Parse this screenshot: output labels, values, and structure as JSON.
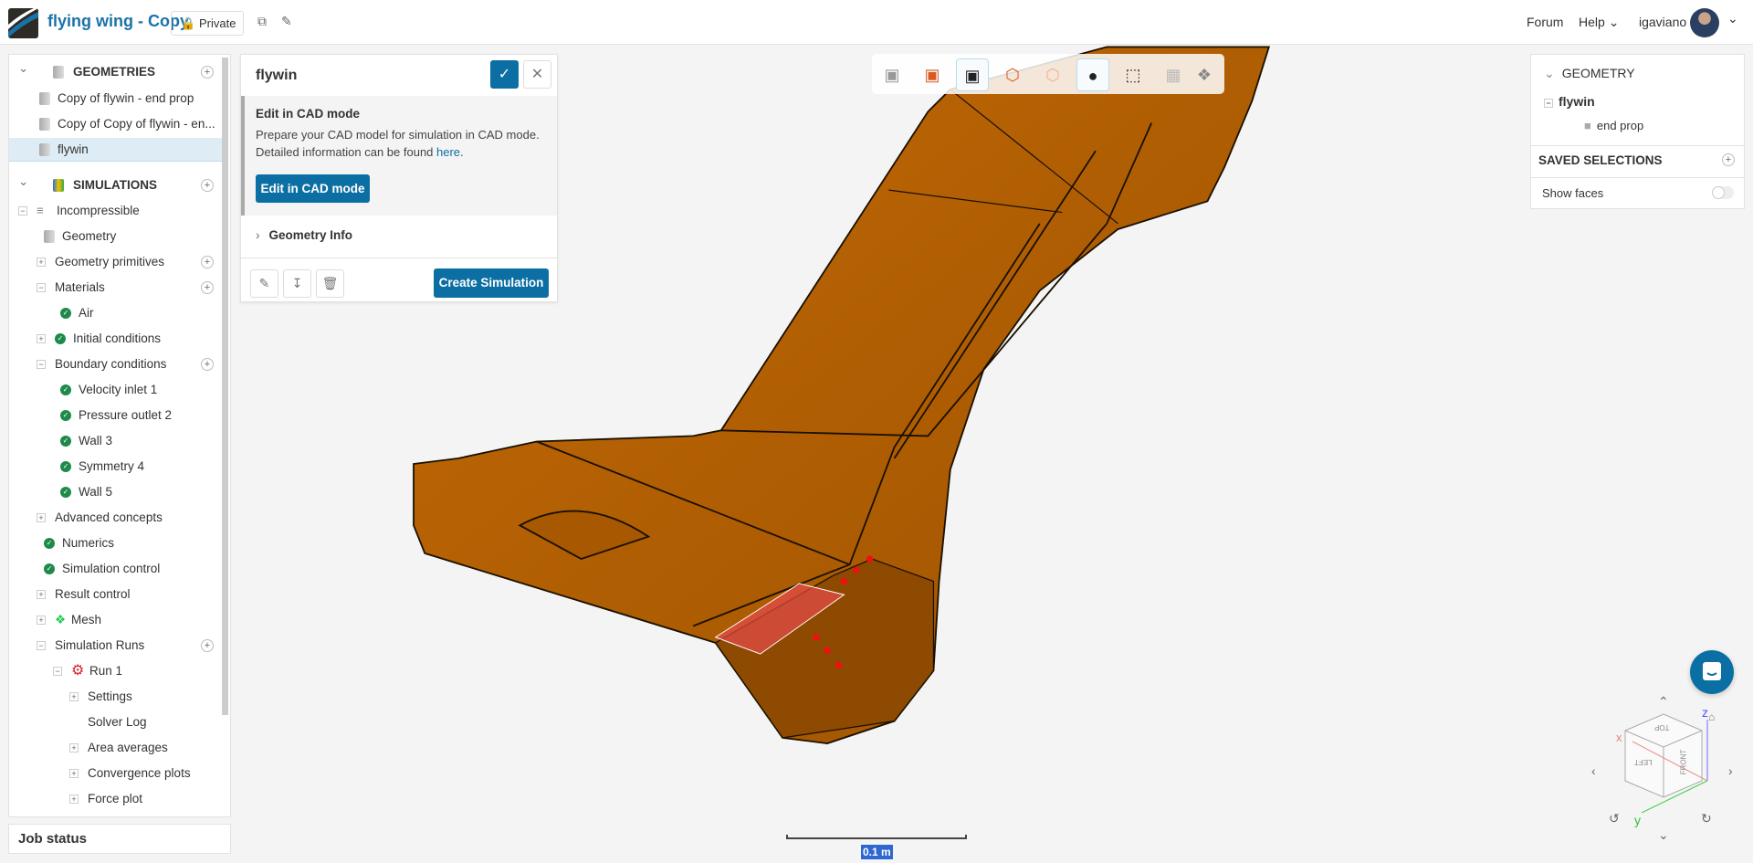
{
  "header": {
    "title": "flying wing - Copy",
    "privacy": "Private",
    "forum": "Forum",
    "help": "Help",
    "user": "igaviano"
  },
  "tree": [
    {
      "level": 0,
      "label": "GEOMETRIES",
      "header": true,
      "toggle": "chev",
      "icon": "geom",
      "add": true
    },
    {
      "level": 1,
      "label": "Copy of flywin - end prop",
      "icon": "geom"
    },
    {
      "level": 1,
      "label": "Copy of Copy of flywin - en...",
      "icon": "geom"
    },
    {
      "level": 1,
      "label": "flywin",
      "icon": "geom",
      "selected": true
    },
    {
      "level": 0,
      "label": "SIMULATIONS",
      "header": true,
      "toggle": "chev",
      "icon": "sim",
      "add": true
    },
    {
      "level": 0,
      "label": "Incompressible",
      "toggle": "minus",
      "icon": "lines"
    },
    {
      "level": 1,
      "label": "Geometry",
      "icon": "geomcheck"
    },
    {
      "level": 1,
      "label": "Geometry primitives",
      "toggle": "plus",
      "add": true
    },
    {
      "level": 1,
      "label": "Materials",
      "toggle": "minus",
      "add": true
    },
    {
      "level": 2,
      "label": "Air",
      "icon": "check"
    },
    {
      "level": 1,
      "label": "Initial conditions",
      "toggle": "plus",
      "icon": "check"
    },
    {
      "level": 1,
      "label": "Boundary conditions",
      "toggle": "minus",
      "add": true
    },
    {
      "level": 2,
      "label": "Velocity inlet 1",
      "icon": "check"
    },
    {
      "level": 2,
      "label": "Pressure outlet 2",
      "icon": "check"
    },
    {
      "level": 2,
      "label": "Wall 3",
      "icon": "check"
    },
    {
      "level": 2,
      "label": "Symmetry 4",
      "icon": "check"
    },
    {
      "level": 2,
      "label": "Wall 5",
      "icon": "check"
    },
    {
      "level": 1,
      "label": "Advanced concepts",
      "toggle": "plus"
    },
    {
      "level": 1,
      "label": "Numerics",
      "icon": "check"
    },
    {
      "level": 1,
      "label": "Simulation control",
      "icon": "check"
    },
    {
      "level": 1,
      "label": "Result control",
      "toggle": "plus"
    },
    {
      "level": 1,
      "label": "Mesh",
      "toggle": "plus",
      "icon": "mesh"
    },
    {
      "level": 1,
      "label": "Simulation Runs",
      "toggle": "minus",
      "add": true
    },
    {
      "level": 2,
      "label": "Run 1",
      "toggle": "minus",
      "icon": "run"
    },
    {
      "level": 3,
      "label": "Settings",
      "toggle": "plus"
    },
    {
      "level": 3,
      "label": "Solver Log"
    },
    {
      "level": 3,
      "label": "Area averages",
      "toggle": "plus"
    },
    {
      "level": 3,
      "label": "Convergence plots",
      "toggle": "plus"
    },
    {
      "level": 3,
      "label": "Force plot",
      "toggle": "plus"
    }
  ],
  "job_status": "Job status",
  "panel": {
    "title": "flywin",
    "cad_heading": "Edit in CAD mode",
    "cad_text": "Prepare your CAD model for simulation in CAD mode. Detailed information can be found ",
    "cad_link": "here",
    "cad_period": ".",
    "cad_button": "Edit in CAD mode",
    "geometry_info": "Geometry Info",
    "create_simulation": "Create Simulation"
  },
  "right": {
    "geometry": "GEOMETRY",
    "root": "flywin",
    "child": "end prop",
    "saved_selections": "SAVED SELECTIONS",
    "show_faces": "Show faces",
    "show_faces_on": false
  },
  "viewport": {
    "scale_label": "0.1 m",
    "cube_top": "TOP",
    "cube_left": "LEFT",
    "cube_front": "FRONT",
    "axis_x": "x",
    "axis_y": "y",
    "axis_z": "z"
  },
  "colors": {
    "accent": "#0c6fa3",
    "model": "#b85f00",
    "selection": "#e84a4a",
    "check": "#1e8a4a"
  }
}
